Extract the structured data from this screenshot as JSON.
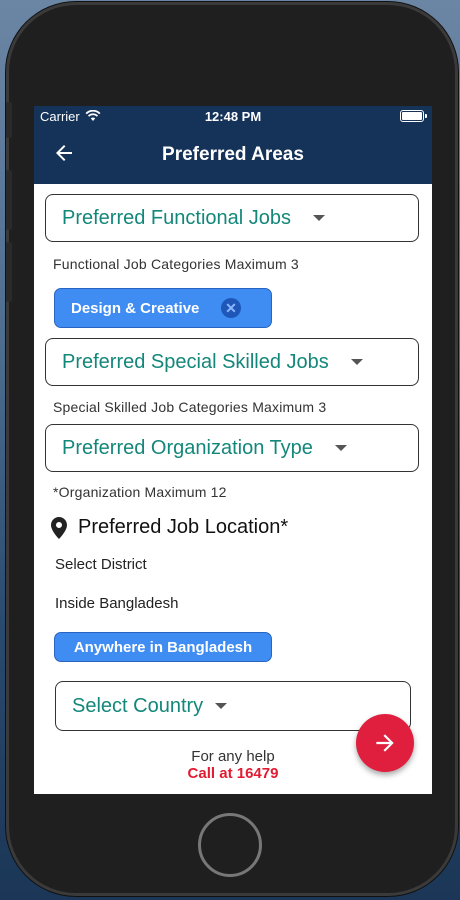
{
  "status_bar": {
    "carrier": "Carrier",
    "time": "12:48 PM"
  },
  "app_bar": {
    "title": "Preferred Areas",
    "back_icon": "arrow-left-icon"
  },
  "functional": {
    "dropdown_label": "Preferred Functional Jobs",
    "hint": "Functional Job Categories Maximum 3",
    "selected_chip": "Design & Creative"
  },
  "special": {
    "dropdown_label": "Preferred Special Skilled Jobs",
    "hint": "Special Skilled Job Categories Maximum 3"
  },
  "organization": {
    "dropdown_label": "Preferred Organization Type",
    "hint": "*Organization Maximum 12"
  },
  "location": {
    "title": "Preferred Job Location*",
    "select_district": "Select District",
    "inside_bangladesh": "Inside Bangladesh",
    "selected_chip": "Anywhere in Bangladesh",
    "country_dropdown": "Select Country"
  },
  "help": {
    "line1": "For any help",
    "line2": "Call at 16479"
  },
  "colors": {
    "appbar": "#153358",
    "accent_teal": "#13877a",
    "chip_blue": "#3f8cf2",
    "fab_red": "#e01f3f"
  }
}
